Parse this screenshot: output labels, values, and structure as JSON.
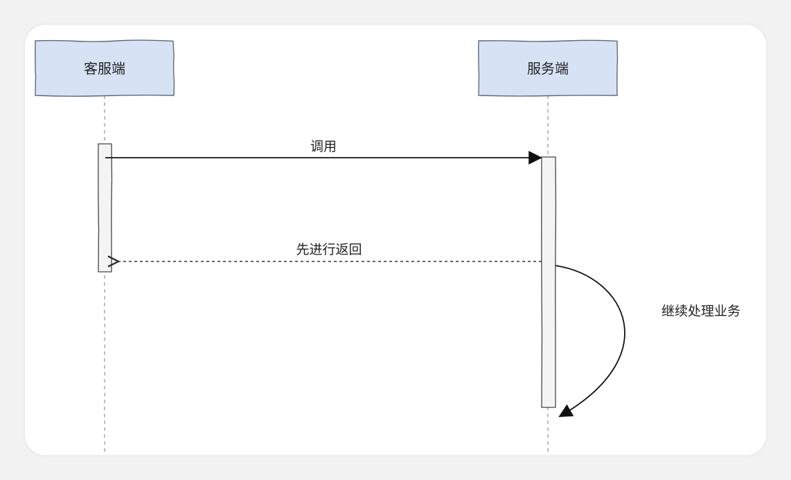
{
  "participants": {
    "client": {
      "label": "客服端"
    },
    "server": {
      "label": "服务端"
    }
  },
  "messages": {
    "call": {
      "label": "调用"
    },
    "early_return": {
      "label": "先进行返回"
    },
    "continue": {
      "label": "继续处理业务"
    }
  },
  "colors": {
    "actor_fill": "#d7e3f5",
    "actor_stroke": "#5a6a7a",
    "line": "#111111",
    "activation_fill": "#f4f4f4",
    "lifeline": "#9a9a9a"
  }
}
